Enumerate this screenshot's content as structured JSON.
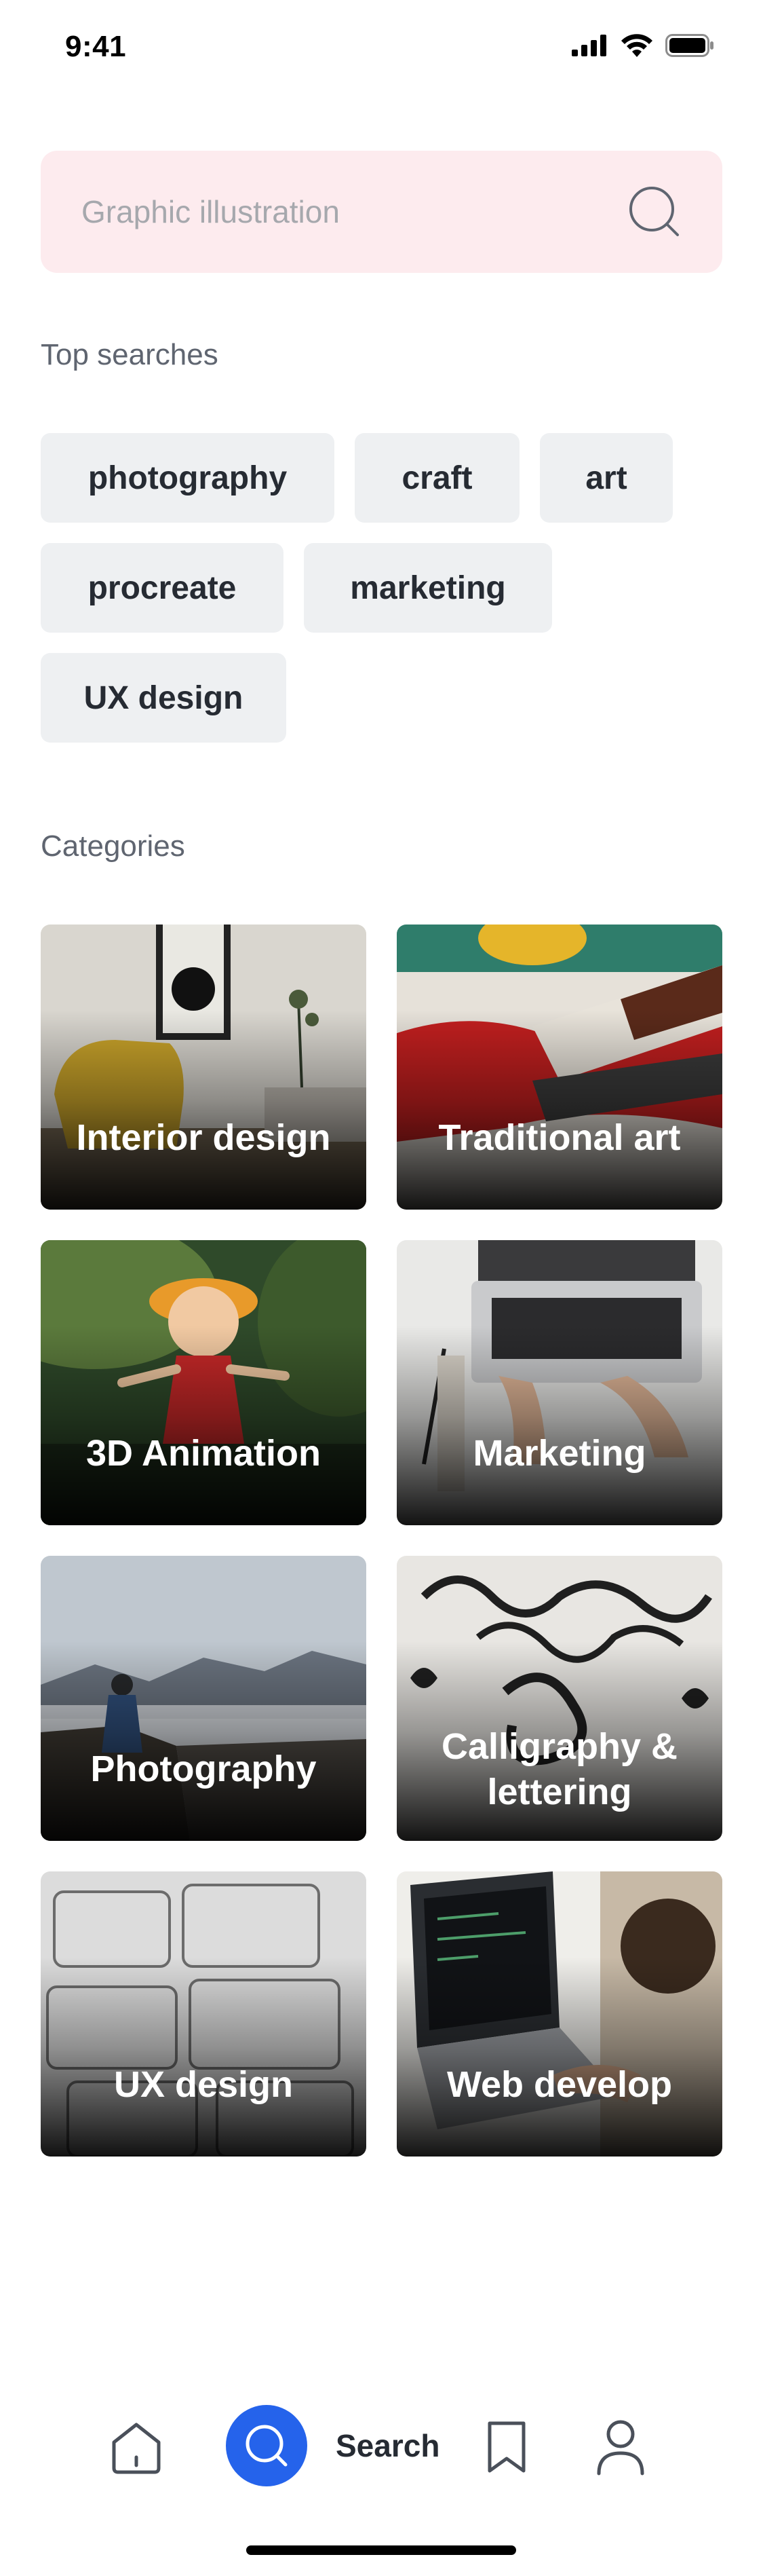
{
  "status_bar": {
    "time": "9:41"
  },
  "search": {
    "placeholder": "Graphic illustration"
  },
  "top_searches": {
    "title": "Top searches",
    "chips": [
      "photography",
      "craft",
      "art",
      "procreate",
      "marketing",
      "UX design"
    ]
  },
  "categories": {
    "title": "Categories",
    "items": [
      "Interior design",
      "Traditional art",
      "3D Animation",
      "Marketing",
      "Photography",
      "Calligraphy & lettering",
      "UX design",
      "Web develop"
    ]
  },
  "tab_bar": {
    "active_label": "Search",
    "items": [
      "home-icon",
      "search-icon",
      "bookmark-icon",
      "profile-icon"
    ]
  },
  "colors": {
    "accent": "#2563eb",
    "search_bg": "#fdebee",
    "chip_bg": "#eef0f2"
  }
}
